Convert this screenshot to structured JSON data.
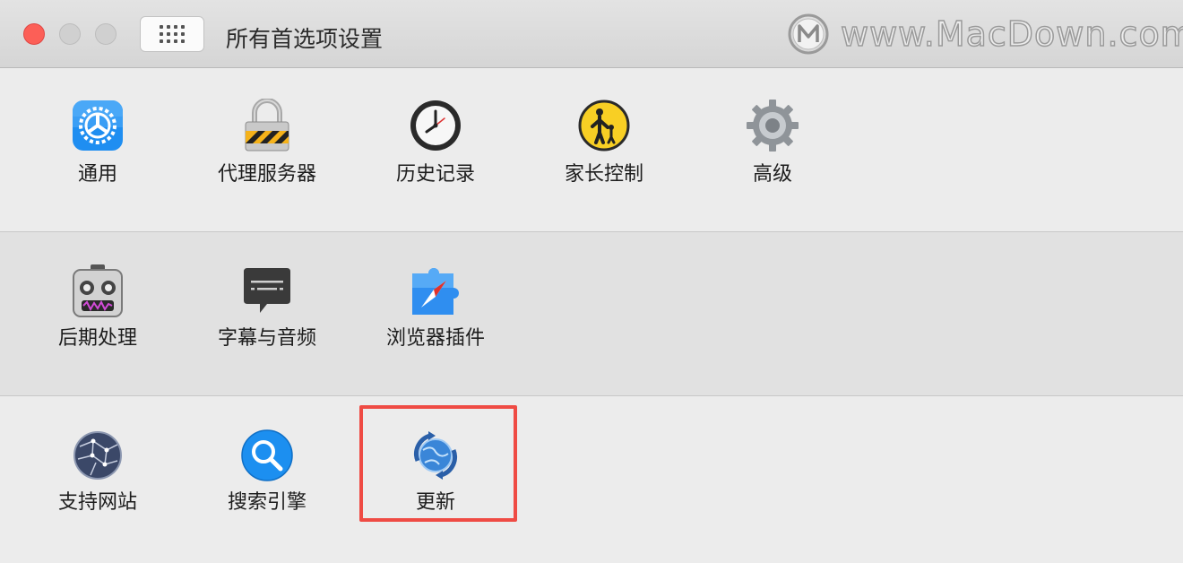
{
  "window": {
    "title": "所有首选项设置",
    "watermark": "www.MacDown.com"
  },
  "colors": {
    "close": "#fc5f57",
    "highlight": "#ef4b44",
    "accent_blue": "#1f8ef1"
  },
  "rows": [
    {
      "items": [
        {
          "label": "通用",
          "icon": "general-icon"
        },
        {
          "label": "代理服务器",
          "icon": "lock-icon"
        },
        {
          "label": "历史记录",
          "icon": "clock-icon"
        },
        {
          "label": "家长控制",
          "icon": "parental-control-icon"
        },
        {
          "label": "高级",
          "icon": "gear-icon"
        }
      ]
    },
    {
      "items": [
        {
          "label": "后期处理",
          "icon": "robot-icon"
        },
        {
          "label": "字幕与音频",
          "icon": "subtitle-bubble-icon"
        },
        {
          "label": "浏览器插件",
          "icon": "safari-puzzle-icon"
        }
      ]
    },
    {
      "items": [
        {
          "label": "支持网站",
          "icon": "globe-icon"
        },
        {
          "label": "搜索引擎",
          "icon": "search-icon"
        },
        {
          "label": "更新",
          "icon": "update-globe-icon"
        }
      ]
    }
  ]
}
